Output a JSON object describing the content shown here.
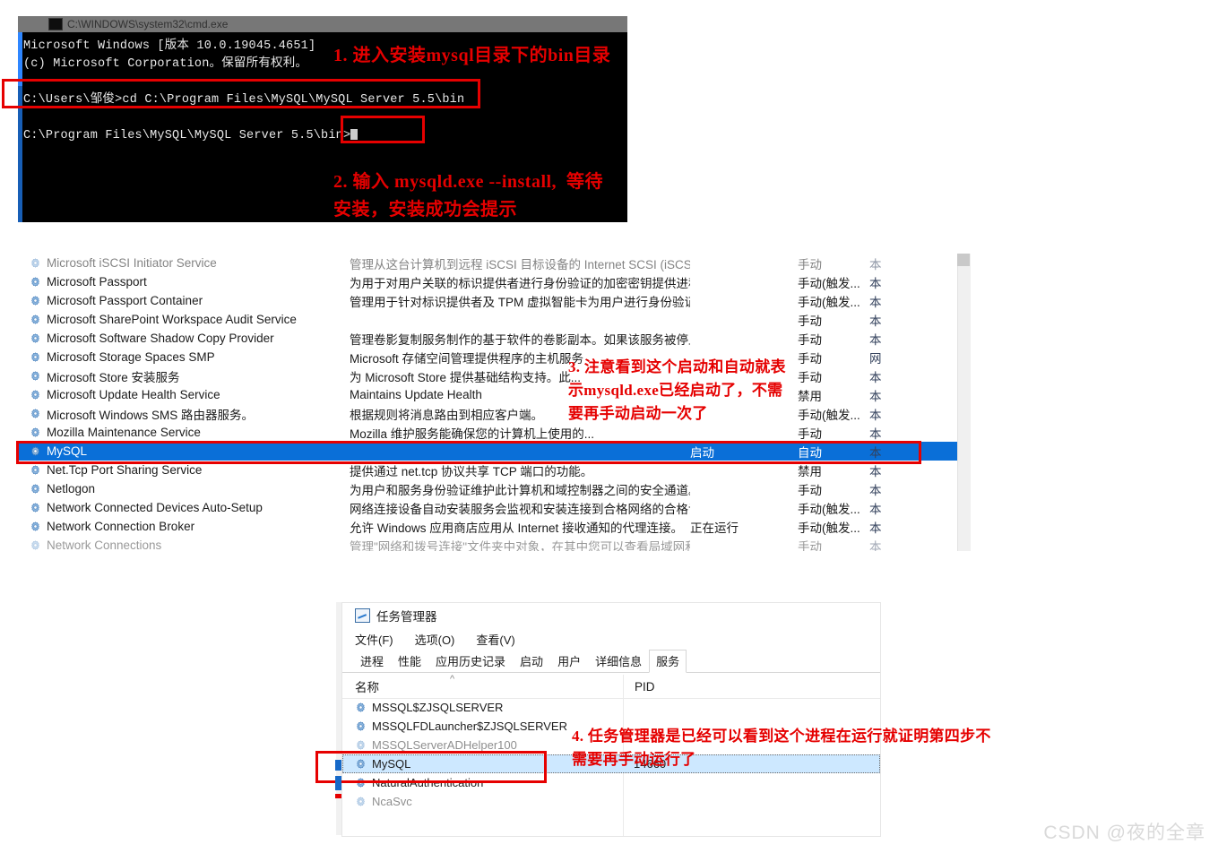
{
  "cmd": {
    "title": "C:\\WINDOWS\\system32\\cmd.exe",
    "line1": "Microsoft Windows [版本 10.0.19045.4651]",
    "line2": "(c) Microsoft Corporation。保留所有权利。",
    "line3": "C:\\Users\\邹俊>cd C:\\Program Files\\MySQL\\MySQL Server 5.5\\bin",
    "line4": "C:\\Program Files\\MySQL\\MySQL Server 5.5\\bin>"
  },
  "annotations": {
    "step1": "1. 进入安装mysql目录下的bin目录",
    "step2": "2. 输入 mysqld.exe --install,  等待\n安装，安装成功会提示",
    "step3": "3. 注意看到这个启动和自动就表\n示mysqld.exe已经启动了，不需\n要再手动启动一次了",
    "step4": "4. 任务管理器是已经可以看到这个进程在运行就证明第四步不\n需要再手动运行了"
  },
  "services": {
    "rows": [
      {
        "name": "Microsoft iSCSI Initiator Service",
        "desc": "管理从这台计算机到远程 iSCSI 目标设备的 Internet SCSI (iSCSI)...",
        "status": "",
        "startup": "手动",
        "logon": "本"
      },
      {
        "name": "Microsoft Passport",
        "desc": "为用于对用户关联的标识提供者进行身份验证的加密密钥提供进程...",
        "status": "",
        "startup": "手动(触发...",
        "logon": "本"
      },
      {
        "name": "Microsoft Passport Container",
        "desc": "管理用于针对标识提供者及 TPM 虚拟智能卡为用户进行身份验证...",
        "status": "",
        "startup": "手动(触发...",
        "logon": "本"
      },
      {
        "name": "Microsoft SharePoint Workspace Audit Service",
        "desc": "",
        "status": "",
        "startup": "手动",
        "logon": "本"
      },
      {
        "name": "Microsoft Software Shadow Copy Provider",
        "desc": "管理卷影复制服务制作的基于软件的卷影副本。如果该服务被停止...",
        "status": "",
        "startup": "手动",
        "logon": "本"
      },
      {
        "name": "Microsoft Storage Spaces SMP",
        "desc": "Microsoft 存储空间管理提供程序的主机服务",
        "status": "",
        "startup": "手动",
        "logon": "网"
      },
      {
        "name": "Microsoft Store 安装服务",
        "desc": "为 Microsoft Store 提供基础结构支持。此...",
        "status": "",
        "startup": "手动",
        "logon": "本"
      },
      {
        "name": "Microsoft Update Health Service",
        "desc": "Maintains Update Health",
        "status": "",
        "startup": "禁用",
        "logon": "本"
      },
      {
        "name": "Microsoft Windows SMS 路由器服务。",
        "desc": "根据规则将消息路由到相应客户端。",
        "status": "",
        "startup": "手动(触发...",
        "logon": "本"
      },
      {
        "name": "Mozilla Maintenance Service",
        "desc": "Mozilla 维护服务能确保您的计算机上使用的...",
        "status": "",
        "startup": "手动",
        "logon": "本"
      },
      {
        "name": "MySQL",
        "desc": "",
        "status": "启动",
        "startup": "自动",
        "logon": "本",
        "selected": true
      },
      {
        "name": "Net.Tcp Port Sharing Service",
        "desc": "提供通过 net.tcp 协议共享 TCP 端口的功能。",
        "status": "",
        "startup": "禁用",
        "logon": "本"
      },
      {
        "name": "Netlogon",
        "desc": "为用户和服务身份验证维护此计算机和域控制器之间的安全通道。...",
        "status": "",
        "startup": "手动",
        "logon": "本"
      },
      {
        "name": "Network Connected Devices Auto-Setup",
        "desc": "网络连接设备自动安装服务会监视和安装连接到合格网络的合格设...",
        "status": "",
        "startup": "手动(触发...",
        "logon": "本"
      },
      {
        "name": "Network Connection Broker",
        "desc": "允许 Windows 应用商店应用从 Internet 接收通知的代理连接。",
        "status": "正在运行",
        "startup": "手动(触发...",
        "logon": "本"
      },
      {
        "name": "Network Connections",
        "desc": "管理\"网络和拨号连接\"文件夹中对象，在其中您可以查看局域网和...",
        "status": "",
        "startup": "手动",
        "logon": "本"
      }
    ]
  },
  "taskmgr": {
    "title": "任务管理器",
    "menu": [
      "文件(F)",
      "选项(O)",
      "查看(V)"
    ],
    "tabs": [
      {
        "label": "进程",
        "active": false
      },
      {
        "label": "性能",
        "active": false
      },
      {
        "label": "应用历史记录",
        "active": false
      },
      {
        "label": "启动",
        "active": false
      },
      {
        "label": "用户",
        "active": false
      },
      {
        "label": "详细信息",
        "active": false
      },
      {
        "label": "服务",
        "active": true
      }
    ],
    "columns": {
      "name": "名称",
      "pid": "PID"
    },
    "rows": [
      {
        "name": "MSSQL$ZJSQLSERVER",
        "pid": ""
      },
      {
        "name": "MSSQLFDLauncher$ZJSQLSERVER",
        "pid": ""
      },
      {
        "name": "MSSQLServerADHelper100",
        "pid": "",
        "faded": true
      },
      {
        "name": "MySQL",
        "pid": "14660",
        "selected": true
      },
      {
        "name": "NaturalAuthentication",
        "pid": ""
      },
      {
        "name": "NcaSvc",
        "pid": "",
        "faded": true
      }
    ]
  },
  "watermark": "CSDN @夜的全章",
  "colors": {
    "annotation_red": "#e50000",
    "redbox": "#e60000",
    "selection_blue": "#0a6fd8",
    "tm_selection": "#cde8ff"
  }
}
